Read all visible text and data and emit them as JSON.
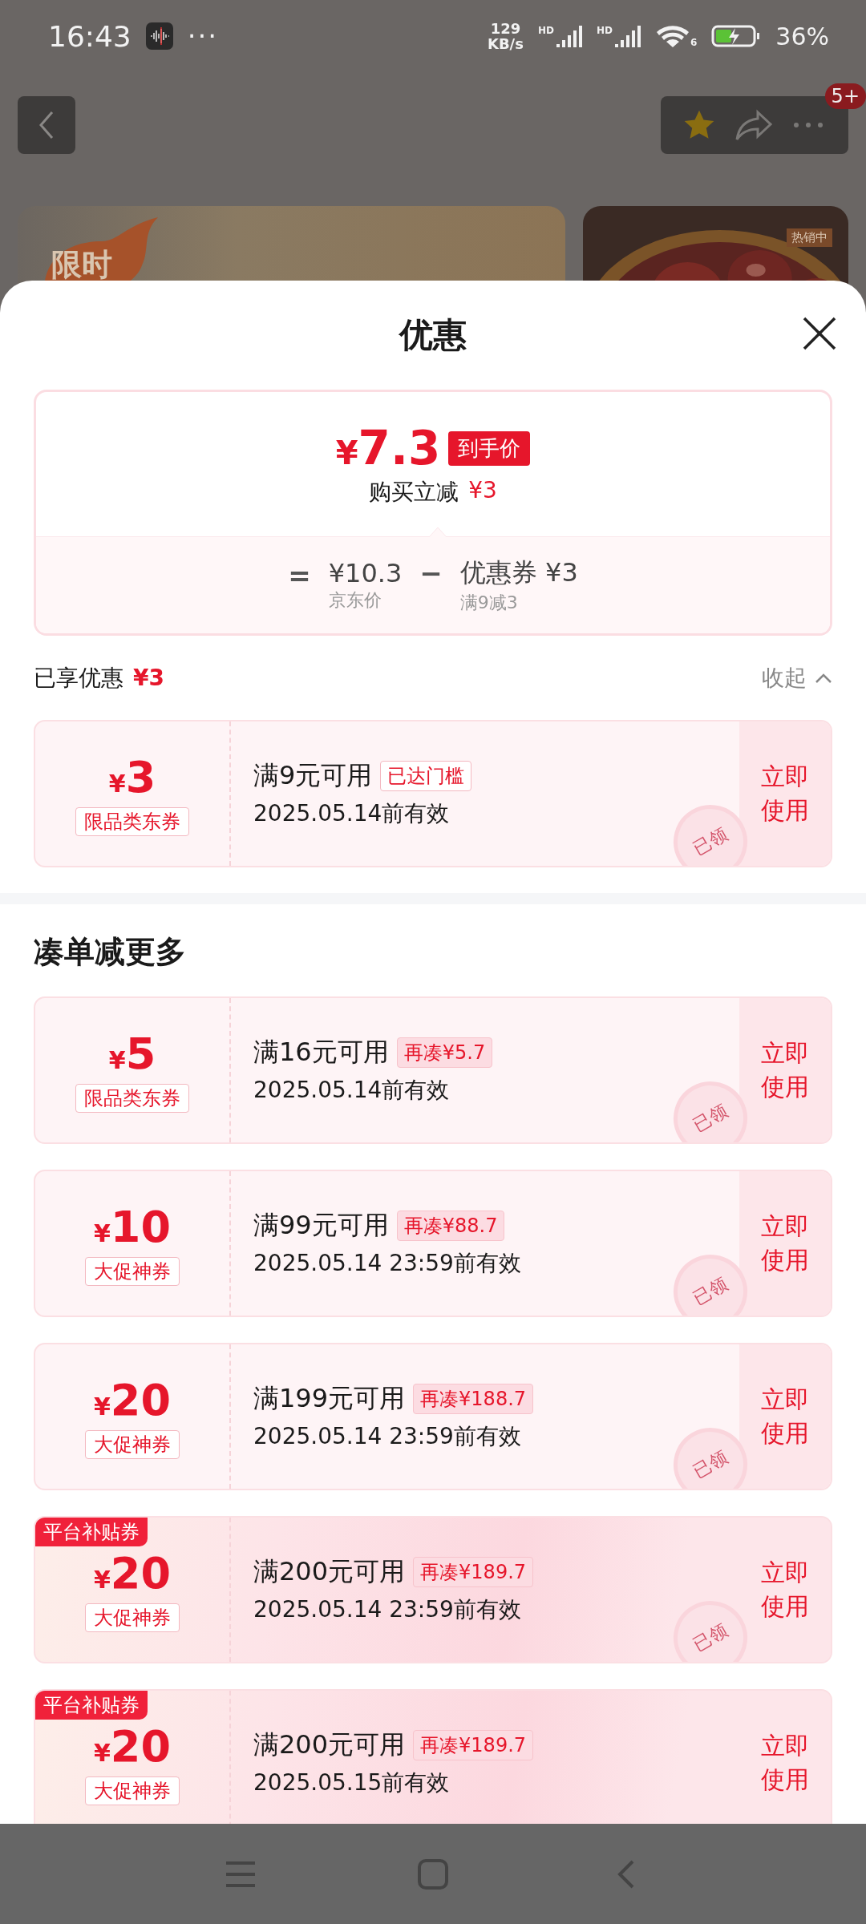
{
  "status_bar": {
    "time": "16:43",
    "more": "···",
    "speed_value": "129",
    "speed_unit": "KB/s",
    "signals": [
      {
        "label": "HD"
      },
      {
        "label": "HD"
      }
    ],
    "wifi_label": "6",
    "battery_percent": "36%"
  },
  "background_page": {
    "badge": "5+",
    "promo_label": "限时",
    "product_tag": "热销中"
  },
  "sheet": {
    "title": "优惠",
    "summary": {
      "currency": "¥",
      "final_price": "7.3",
      "price_tag": "到手价",
      "instant_discount_label": "购买立减",
      "instant_discount_amount": "¥3",
      "breakdown": [
        {
          "operator": "=",
          "amount": "¥10.3",
          "note": "京东价"
        },
        {
          "operator": "−",
          "amount": "优惠券 ¥3",
          "note": "满9减3"
        }
      ]
    },
    "applied": {
      "label": "已享优惠",
      "amount": "¥3",
      "collapse": "收起"
    },
    "applied_coupons": [
      {
        "kind": "plain",
        "currency": "¥",
        "amount": "3",
        "type_tag": "限品类东券",
        "condition": "满9元可用",
        "status_tag": {
          "kind": "reached",
          "text": "已达门槛"
        },
        "validity": "2025.05.14前有效",
        "action": "立即使用",
        "stamp": "已领"
      }
    ],
    "more_title": "凑单减更多",
    "more_coupons": [
      {
        "kind": "plain",
        "currency": "¥",
        "amount": "5",
        "type_tag": "限品类东券",
        "condition": "满16元可用",
        "status_tag": {
          "kind": "short",
          "text": "再凑¥5.7"
        },
        "validity": "2025.05.14前有效",
        "action": "立即使用",
        "stamp": "已领"
      },
      {
        "kind": "plain",
        "currency": "¥",
        "amount": "10",
        "type_tag": "大促神券",
        "condition": "满99元可用",
        "status_tag": {
          "kind": "short",
          "text": "再凑¥88.7"
        },
        "validity": "2025.05.14 23:59前有效",
        "action": "立即使用",
        "stamp": "已领"
      },
      {
        "kind": "plain",
        "currency": "¥",
        "amount": "20",
        "type_tag": "大促神券",
        "condition": "满199元可用",
        "status_tag": {
          "kind": "short",
          "text": "再凑¥188.7"
        },
        "validity": "2025.05.14 23:59前有效",
        "action": "立即使用",
        "stamp": "已领"
      },
      {
        "kind": "platform",
        "ribbon": "平台补贴券",
        "currency": "¥",
        "amount": "20",
        "type_tag": "大促神券",
        "condition": "满200元可用",
        "status_tag": {
          "kind": "short",
          "text": "再凑¥189.7"
        },
        "validity": "2025.05.14 23:59前有效",
        "action": "立即使用",
        "stamp": "已领"
      },
      {
        "kind": "platform",
        "ribbon": "平台补贴券",
        "currency": "¥",
        "amount": "20",
        "type_tag": "大促神券",
        "condition": "满200元可用",
        "status_tag": {
          "kind": "short",
          "text": "再凑¥189.7"
        },
        "validity": "2025.05.15前有效",
        "action": "立即使用"
      }
    ]
  }
}
